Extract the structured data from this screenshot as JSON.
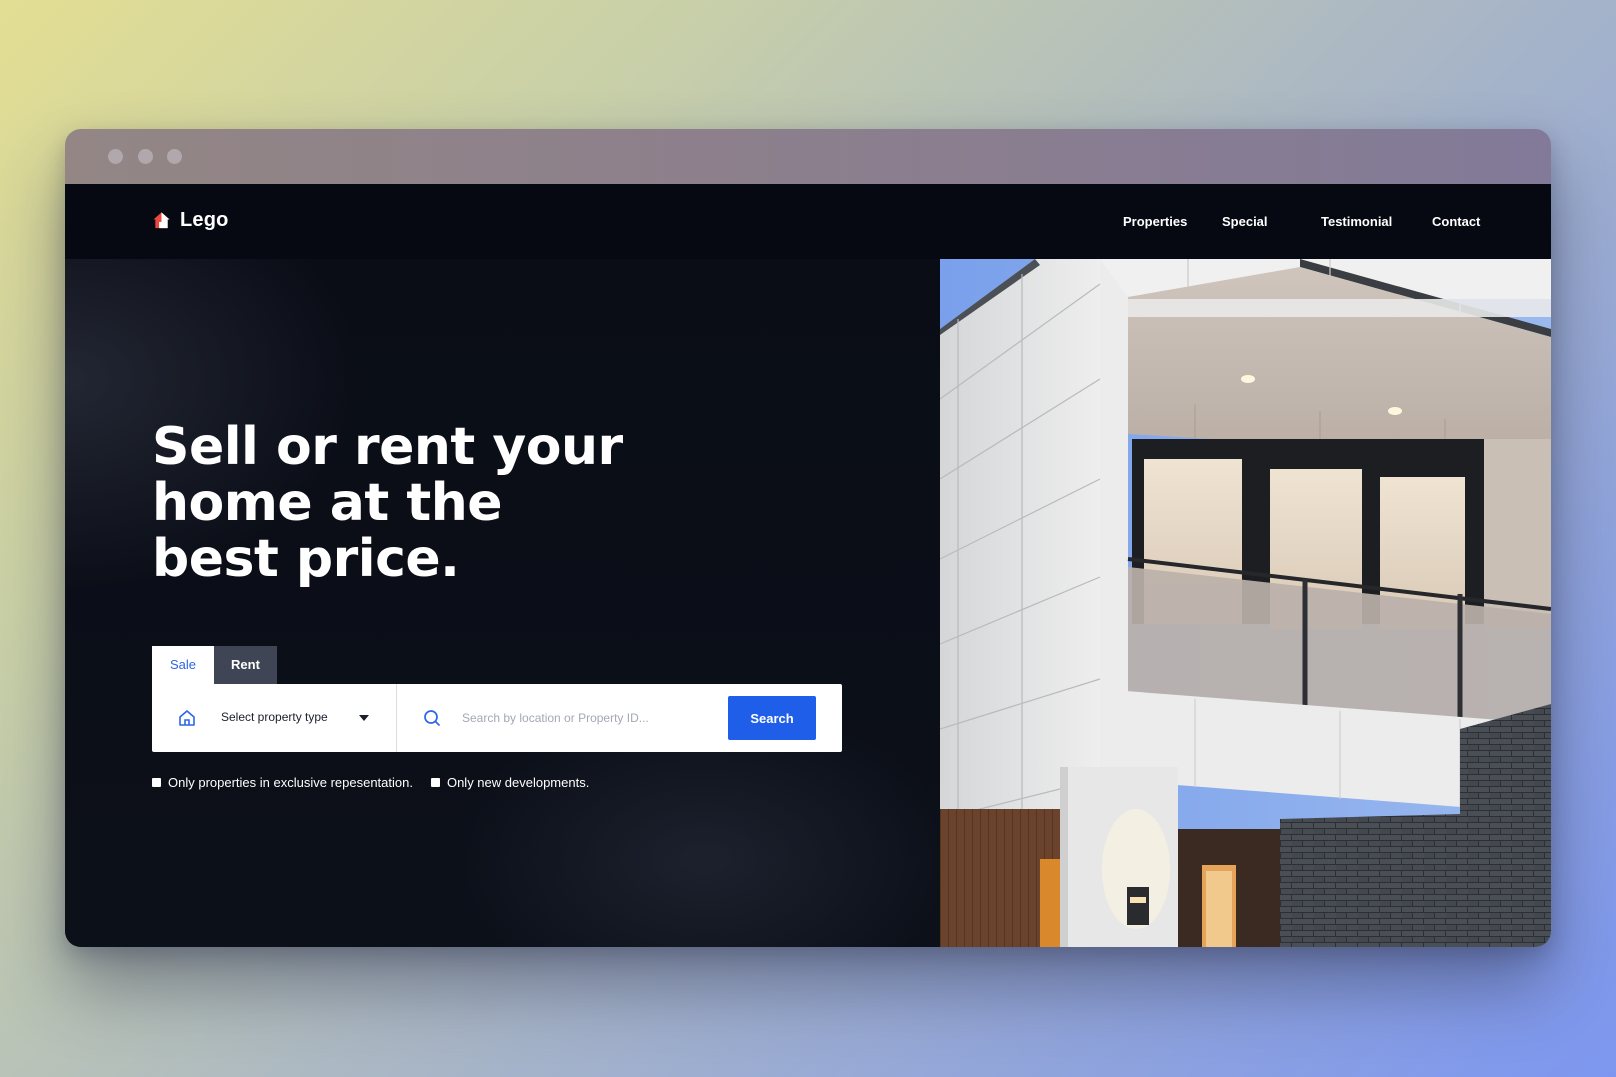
{
  "window": {
    "controls": [
      "close",
      "minimize",
      "maximize"
    ]
  },
  "brand": {
    "name": "Lego",
    "icon": "house-icon",
    "icon_color": "#e8483f"
  },
  "nav": {
    "items": [
      {
        "label": "Properties"
      },
      {
        "label": "Special"
      },
      {
        "label": "Testimonial"
      },
      {
        "label": "Contact"
      }
    ]
  },
  "hero": {
    "headline": "Sell or rent your home at the best price."
  },
  "search": {
    "tabs": [
      {
        "label": "Sale",
        "active": true
      },
      {
        "label": "Rent",
        "active": false
      }
    ],
    "property_type": {
      "selected_label": "Select property type",
      "icon": "home-outline-icon"
    },
    "query": {
      "value": "",
      "placeholder": "Search by location or Property ID...",
      "icon": "search-icon"
    },
    "button_label": "Search"
  },
  "filters": [
    {
      "label": "Only properties in exclusive repesentation.",
      "checked": false
    },
    {
      "label": "Only new developments.",
      "checked": false
    }
  ],
  "colors": {
    "accent": "#1f5ee9",
    "background": "#0b0e17",
    "tab_inactive": "#3f4554"
  }
}
